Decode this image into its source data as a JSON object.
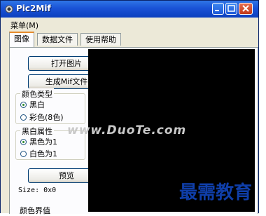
{
  "window": {
    "title": "Pic2Mif"
  },
  "menubar": {
    "items": [
      {
        "label": "菜单(M)"
      }
    ]
  },
  "tabs": [
    {
      "label": "图像"
    },
    {
      "label": "数据文件"
    },
    {
      "label": "使用帮助"
    }
  ],
  "buttons": {
    "open_image": "打开图片",
    "generate_mif": "生成Mif文件",
    "preview": "预览"
  },
  "color_type": {
    "title": "颜色类型",
    "options": [
      "黑白",
      "彩色(8色)"
    ],
    "selected": "黑白"
  },
  "bw_property": {
    "title": "黑白属性",
    "options": [
      "黑色为1",
      "白色为1"
    ],
    "selected": "黑色为1"
  },
  "size_text": "Size: 0x0",
  "bottom_section_label": "颜色界值",
  "watermark": "www.DuoTe.com",
  "brand_overlay": "最需教育",
  "colors": {
    "title_bar": "#1a52d6",
    "canvas": "#000000",
    "brand": "#0f3ea8"
  }
}
